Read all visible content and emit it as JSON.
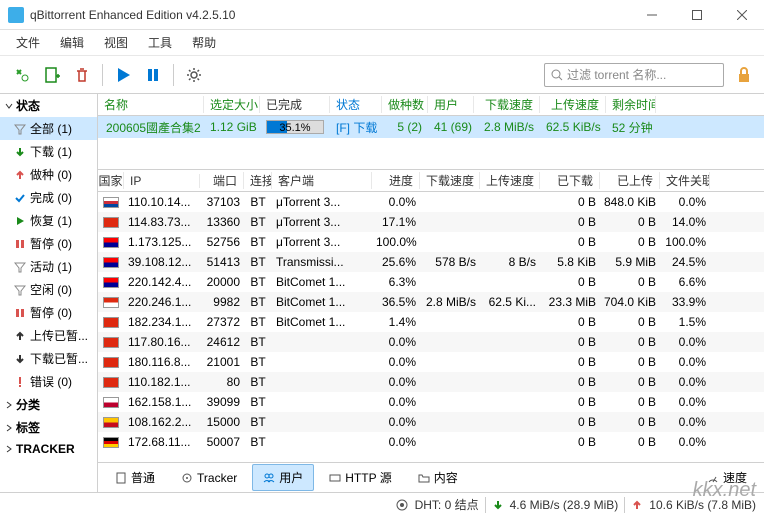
{
  "window": {
    "title": "qBittorrent Enhanced Edition v4.2.5.10"
  },
  "menu": [
    "文件",
    "编辑",
    "视图",
    "工具",
    "帮助"
  ],
  "filter_placeholder": "过滤 torrent 名称...",
  "sidebar": {
    "cat_status": "状态",
    "items": [
      {
        "label": "全部 (1)",
        "icon": "filter",
        "color": "#888",
        "sel": true
      },
      {
        "label": "下载 (1)",
        "icon": "down",
        "color": "#1a8a1a"
      },
      {
        "label": "做种 (0)",
        "icon": "up",
        "color": "#d9534f"
      },
      {
        "label": "完成 (0)",
        "icon": "check",
        "color": "#0078d4"
      },
      {
        "label": "恢复 (1)",
        "icon": "play",
        "color": "#1a8a1a"
      },
      {
        "label": "暂停 (0)",
        "icon": "pause",
        "color": "#d9534f"
      },
      {
        "label": "活动 (1)",
        "icon": "filter",
        "color": "#888"
      },
      {
        "label": "空闲 (0)",
        "icon": "filter",
        "color": "#888"
      },
      {
        "label": "暂停 (0)",
        "icon": "pause",
        "color": "#d9534f"
      },
      {
        "label": "上传已暂...",
        "icon": "up",
        "color": "#333"
      },
      {
        "label": "下载已暂...",
        "icon": "down",
        "color": "#333"
      },
      {
        "label": "错误 (0)",
        "icon": "error",
        "color": "#d9534f"
      }
    ],
    "cat_category": "分类",
    "cat_tags": "标签",
    "cat_tracker": "TRACKER"
  },
  "torrent_headers": [
    "名称",
    "选定大小",
    "已完成",
    "状态",
    "做种数",
    "用户",
    "下载速度",
    "上传速度",
    "剩余时间"
  ],
  "torrents": [
    {
      "name": "200605國產合集2",
      "size": "1.12 GiB",
      "progress": "35.1%",
      "progress_pct": 35,
      "status": "[F] 下载",
      "seeds": "5 (2)",
      "peers": "41 (69)",
      "dl": "2.8 MiB/s",
      "ul": "62.5 KiB/s",
      "eta": "52 分钟"
    }
  ],
  "peer_headers": [
    "国家",
    "IP",
    "端口",
    "连接",
    "客户端",
    "进度",
    "下载速度",
    "上传速度",
    "已下载",
    "已上传",
    "文件关联"
  ],
  "peers": [
    {
      "flag": "#fff,#cd2e3a,#0047a0",
      "ip": "110.10.14...",
      "port": "37103",
      "conn": "BT",
      "client": "μTorrent 3...",
      "prog": "0.0%",
      "dl": "",
      "ul": "",
      "dld": "0 B",
      "uld": "848.0 KiB",
      "rel": "0.0%"
    },
    {
      "flag": "#de2910",
      "ip": "114.83.73...",
      "port": "13360",
      "conn": "BT",
      "client": "μTorrent 3...",
      "prog": "17.1%",
      "dl": "",
      "ul": "",
      "dld": "0 B",
      "uld": "0 B",
      "rel": "14.0%"
    },
    {
      "flag": "#fe0000,#000095",
      "ip": "1.173.125...",
      "port": "52756",
      "conn": "BT",
      "client": "μTorrent 3...",
      "prog": "100.0%",
      "dl": "",
      "ul": "",
      "dld": "0 B",
      "uld": "0 B",
      "rel": "100.0%"
    },
    {
      "flag": "#fe0000,#000095",
      "ip": "39.108.12...",
      "port": "51413",
      "conn": "BT",
      "client": "Transmissi...",
      "prog": "25.6%",
      "dl": "578 B/s",
      "ul": "8 B/s",
      "dld": "5.8 KiB",
      "uld": "5.9 MiB",
      "rel": "24.5%"
    },
    {
      "flag": "#fe0000,#000095",
      "ip": "220.142.4...",
      "port": "20000",
      "conn": "BT",
      "client": "BitComet 1...",
      "prog": "6.3%",
      "dl": "",
      "ul": "",
      "dld": "0 B",
      "uld": "0 B",
      "rel": "6.6%"
    },
    {
      "flag": "#de2910,#fff",
      "ip": "220.246.1...",
      "port": "9982",
      "conn": "BT",
      "client": "BitComet 1...",
      "prog": "36.5%",
      "dl": "2.8 MiB/s",
      "ul": "62.5 Ki...",
      "dld": "23.3 MiB",
      "uld": "704.0 KiB",
      "rel": "33.9%"
    },
    {
      "flag": "#de2910",
      "ip": "182.234.1...",
      "port": "27372",
      "conn": "BT",
      "client": "BitComet 1...",
      "prog": "1.4%",
      "dl": "",
      "ul": "",
      "dld": "0 B",
      "uld": "0 B",
      "rel": "1.5%"
    },
    {
      "flag": "#de2910",
      "ip": "117.80.16...",
      "port": "24612",
      "conn": "BT",
      "client": "",
      "prog": "0.0%",
      "dl": "",
      "ul": "",
      "dld": "0 B",
      "uld": "0 B",
      "rel": "0.0%"
    },
    {
      "flag": "#de2910",
      "ip": "180.116.8...",
      "port": "21001",
      "conn": "BT",
      "client": "",
      "prog": "0.0%",
      "dl": "",
      "ul": "",
      "dld": "0 B",
      "uld": "0 B",
      "rel": "0.0%"
    },
    {
      "flag": "#de2910",
      "ip": "110.182.1...",
      "port": "80",
      "conn": "BT",
      "client": "",
      "prog": "0.0%",
      "dl": "",
      "ul": "",
      "dld": "0 B",
      "uld": "0 B",
      "rel": "0.0%"
    },
    {
      "flag": "#fff,#bc002d",
      "ip": "162.158.1...",
      "port": "39099",
      "conn": "BT",
      "client": "",
      "prog": "0.0%",
      "dl": "",
      "ul": "",
      "dld": "0 B",
      "uld": "0 B",
      "rel": "0.0%"
    },
    {
      "flag": "#ffc400,#c60b1e",
      "ip": "108.162.2...",
      "port": "15000",
      "conn": "BT",
      "client": "",
      "prog": "0.0%",
      "dl": "",
      "ul": "",
      "dld": "0 B",
      "uld": "0 B",
      "rel": "0.0%"
    },
    {
      "flag": "#000,#dd0000,#ffce00",
      "ip": "172.68.11...",
      "port": "50007",
      "conn": "BT",
      "client": "",
      "prog": "0.0%",
      "dl": "",
      "ul": "",
      "dld": "0 B",
      "uld": "0 B",
      "rel": "0.0%"
    }
  ],
  "tabs": [
    {
      "label": "普通",
      "icon": "doc"
    },
    {
      "label": "Tracker",
      "icon": "tracker"
    },
    {
      "label": "用户",
      "icon": "users",
      "active": true
    },
    {
      "label": "HTTP 源",
      "icon": "http"
    },
    {
      "label": "内容",
      "icon": "folder"
    }
  ],
  "tab_speed": "速度",
  "status": {
    "dht": "DHT: 0 结点",
    "dl": "4.6 MiB/s (28.9 MiB)",
    "ul": "10.6 KiB/s (7.8 MiB)"
  },
  "watermark": "kkx.net"
}
